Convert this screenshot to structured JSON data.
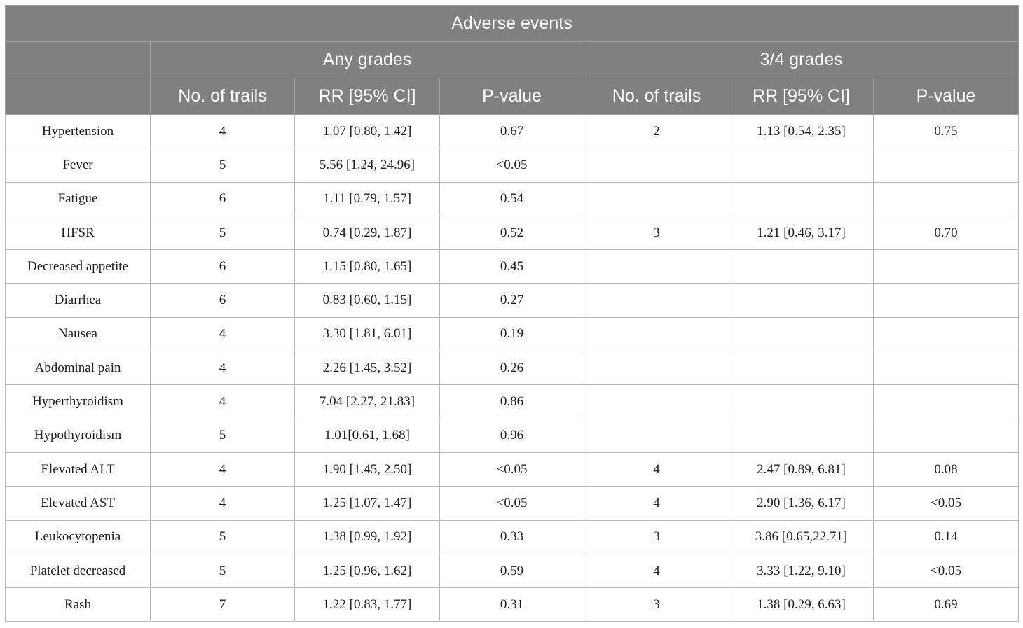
{
  "table": {
    "title": "Adverse events",
    "groups": [
      "Any grades",
      "3/4 grades"
    ],
    "columns": [
      "No. of trails",
      "RR [95% CI]",
      "P-value",
      "No. of trails",
      "RR [95% CI]",
      "P-value"
    ],
    "rows": [
      [
        "Hypertension",
        "4",
        "1.07 [0.80, 1.42]",
        "0.67",
        "2",
        "1.13 [0.54, 2.35]",
        "0.75"
      ],
      [
        "Fever",
        "5",
        "5.56 [1.24, 24.96]",
        "<0.05",
        "",
        "",
        ""
      ],
      [
        "Fatigue",
        "6",
        "1.11 [0.79, 1.57]",
        "0.54",
        "",
        "",
        ""
      ],
      [
        "HFSR",
        "5",
        "0.74 [0.29, 1.87]",
        "0.52",
        "3",
        "1.21 [0.46, 3.17]",
        "0.70"
      ],
      [
        "Decreased appetite",
        "6",
        "1.15 [0.80, 1.65]",
        "0.45",
        "",
        "",
        ""
      ],
      [
        "Diarrhea",
        "6",
        "0.83 [0.60, 1.15]",
        "0.27",
        "",
        "",
        ""
      ],
      [
        "Nausea",
        "4",
        "3.30 [1.81, 6.01]",
        "0.19",
        "",
        "",
        ""
      ],
      [
        "Abdominal pain",
        "4",
        "2.26 [1.45, 3.52]",
        "0.26",
        "",
        "",
        ""
      ],
      [
        "Hyperthyroidism",
        "4",
        "7.04 [2.27, 21.83]",
        "0.86",
        "",
        "",
        ""
      ],
      [
        "Hypothyroidism",
        "5",
        "1.01[0.61, 1.68]",
        "0.96",
        "",
        "",
        ""
      ],
      [
        "Elevated ALT",
        "4",
        "1.90 [1.45, 2.50]",
        "<0.05",
        "4",
        "2.47 [0.89, 6.81]",
        "0.08"
      ],
      [
        "Elevated AST",
        "4",
        "1.25 [1.07, 1.47]",
        "<0.05",
        "4",
        "2.90 [1.36, 6.17]",
        "<0.05"
      ],
      [
        "Leukocytopenia",
        "5",
        "1.38 [0.99, 1.92]",
        "0.33",
        "3",
        "3.86 [0.65,22.71]",
        "0.14"
      ],
      [
        "Platelet decreased",
        "5",
        "1.25 [0.96, 1.62]",
        "0.59",
        "4",
        "3.33 [1.22, 9.10]",
        "<0.05"
      ],
      [
        "Rash",
        "7",
        "1.22 [0.83, 1.77]",
        "0.31",
        "3",
        "1.38 [0.29, 6.63]",
        "0.69"
      ]
    ]
  }
}
